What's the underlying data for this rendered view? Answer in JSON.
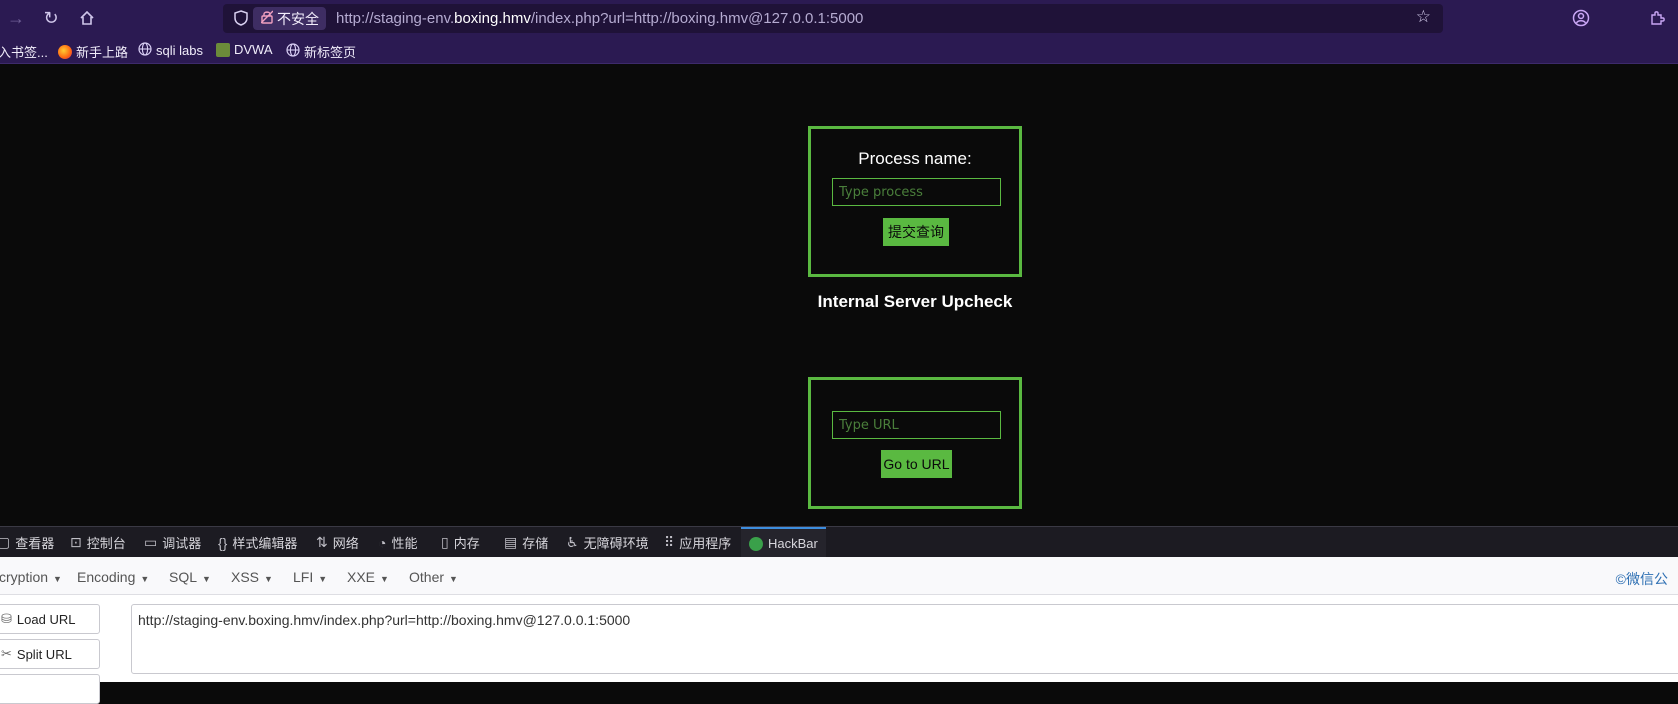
{
  "browser": {
    "security_label": "不安全",
    "url_prefix": "http://staging-env.",
    "url_domain": "boxing.hmv",
    "url_suffix": "/index.php?url=http://boxing.hmv@127.0.0.1:5000",
    "bookmarks": [
      {
        "label": "入书签..."
      },
      {
        "label": "新手上路"
      },
      {
        "label": "sqli labs"
      },
      {
        "label": "DVWA"
      },
      {
        "label": "新标签页"
      }
    ]
  },
  "page": {
    "process_label": "Process name:",
    "process_placeholder": "Type process",
    "submit_label": "提交查询",
    "heading": "Internal Server Upcheck",
    "url_placeholder": "Type URL",
    "goto_label": "Go to URL"
  },
  "devtools": {
    "tabs": [
      "查看器",
      "控制台",
      "调试器",
      "样式编辑器",
      "网络",
      "性能",
      "内存",
      "存储",
      "无障碍环境",
      "应用程序",
      "HackBar"
    ]
  },
  "hackbar": {
    "menus": [
      "cryption",
      "Encoding",
      "SQL",
      "XSS",
      "LFI",
      "XXE",
      "Other"
    ],
    "credit": "©微信公",
    "load_url": "Load URL",
    "split_url": "Split URL",
    "url_value": "http://staging-env.boxing.hmv/index.php?url=http://boxing.hmv@127.0.0.1:5000"
  }
}
